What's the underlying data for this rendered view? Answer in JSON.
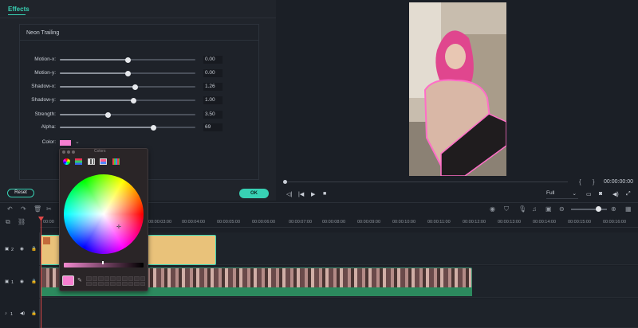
{
  "effects_panel": {
    "tab_label": "Effects",
    "section_title": "Neon Trailing",
    "params": [
      {
        "label": "Motion-x:",
        "value": "0.00",
        "fraction": 0.5
      },
      {
        "label": "Motion-y:",
        "value": "0.00",
        "fraction": 0.5
      },
      {
        "label": "Shadow-x:",
        "value": "1.26",
        "fraction": 0.55
      },
      {
        "label": "Shadow-y:",
        "value": "1.00",
        "fraction": 0.54
      },
      {
        "label": "Strength:",
        "value": "3.50",
        "fraction": 0.35
      },
      {
        "label": "Alpha:",
        "value": "69",
        "fraction": 0.69
      }
    ],
    "color_label": "Color:",
    "color_value": "#f77fd0",
    "reset_label": "Reset",
    "ok_label": "OK"
  },
  "colors_popup": {
    "title": "Colors",
    "current_color": "#f77fd0",
    "tools": [
      "color-wheel-icon",
      "sliders-icon",
      "palettes-icon",
      "image-palette-icon",
      "pencils-icon"
    ]
  },
  "preview": {
    "timecode": "00:00:00:00",
    "quality": "Full",
    "bracket_glyphs": "{ }"
  },
  "timeline": {
    "ruler_labels": [
      "00:00",
      "00:00:03:00",
      "00:00:04:00",
      "00:00:05:00",
      "00:00:06:00",
      "00:00:07:00",
      "00:00:08:00",
      "00:00:09:00",
      "00:00:10:00",
      "00:00:11:00",
      "00:00:12:00",
      "00:00:13:00",
      "00:00:14:00",
      "00:00:15:00",
      "00:00:16:00"
    ],
    "tracks": [
      {
        "label": "2"
      },
      {
        "label": "1"
      },
      {
        "label": "1"
      }
    ]
  },
  "colors": {
    "accent": "#38d1b4",
    "playhead": "#e04848"
  }
}
